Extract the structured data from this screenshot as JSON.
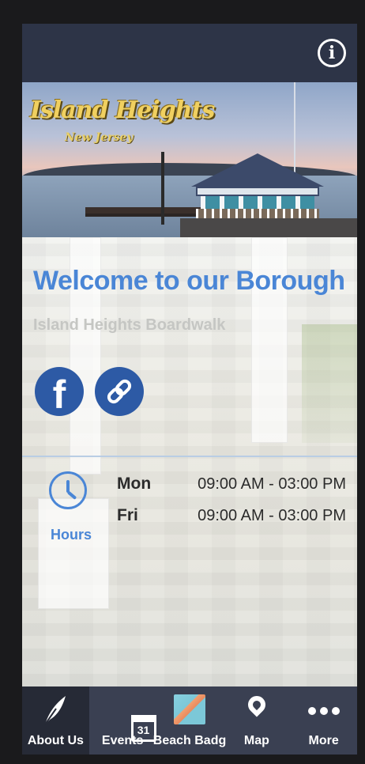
{
  "header": {
    "info_icon": "i"
  },
  "hero": {
    "title": "Island Heights",
    "subtitle": "New Jersey"
  },
  "content": {
    "welcome": "Welcome to our Borough",
    "subtitle": "Island Heights Boardwalk",
    "facebook_glyph": "f"
  },
  "hours": {
    "label": "Hours",
    "rows": [
      {
        "day": "Mon",
        "time": "09:00 AM - 03:00 PM"
      },
      {
        "day": "Fri",
        "time": "09:00 AM - 03:00 PM"
      }
    ]
  },
  "tabs": [
    {
      "label": "About Us",
      "icon": "feather-icon",
      "active": true
    },
    {
      "label": "Events",
      "icon": "calendar-icon",
      "calendar_day": "31"
    },
    {
      "label": "Beach Badg",
      "icon": "beach-badge-image"
    },
    {
      "label": "Map",
      "icon": "map-pin-icon"
    },
    {
      "label": "More",
      "icon": "more-dots-icon"
    }
  ],
  "colors": {
    "header_bg": "#2d3447",
    "accent_blue": "#4a86d6",
    "social_blue": "#2d5aa5",
    "tabbar_bg": "#3a4052",
    "tab_active_bg": "#262a36"
  }
}
